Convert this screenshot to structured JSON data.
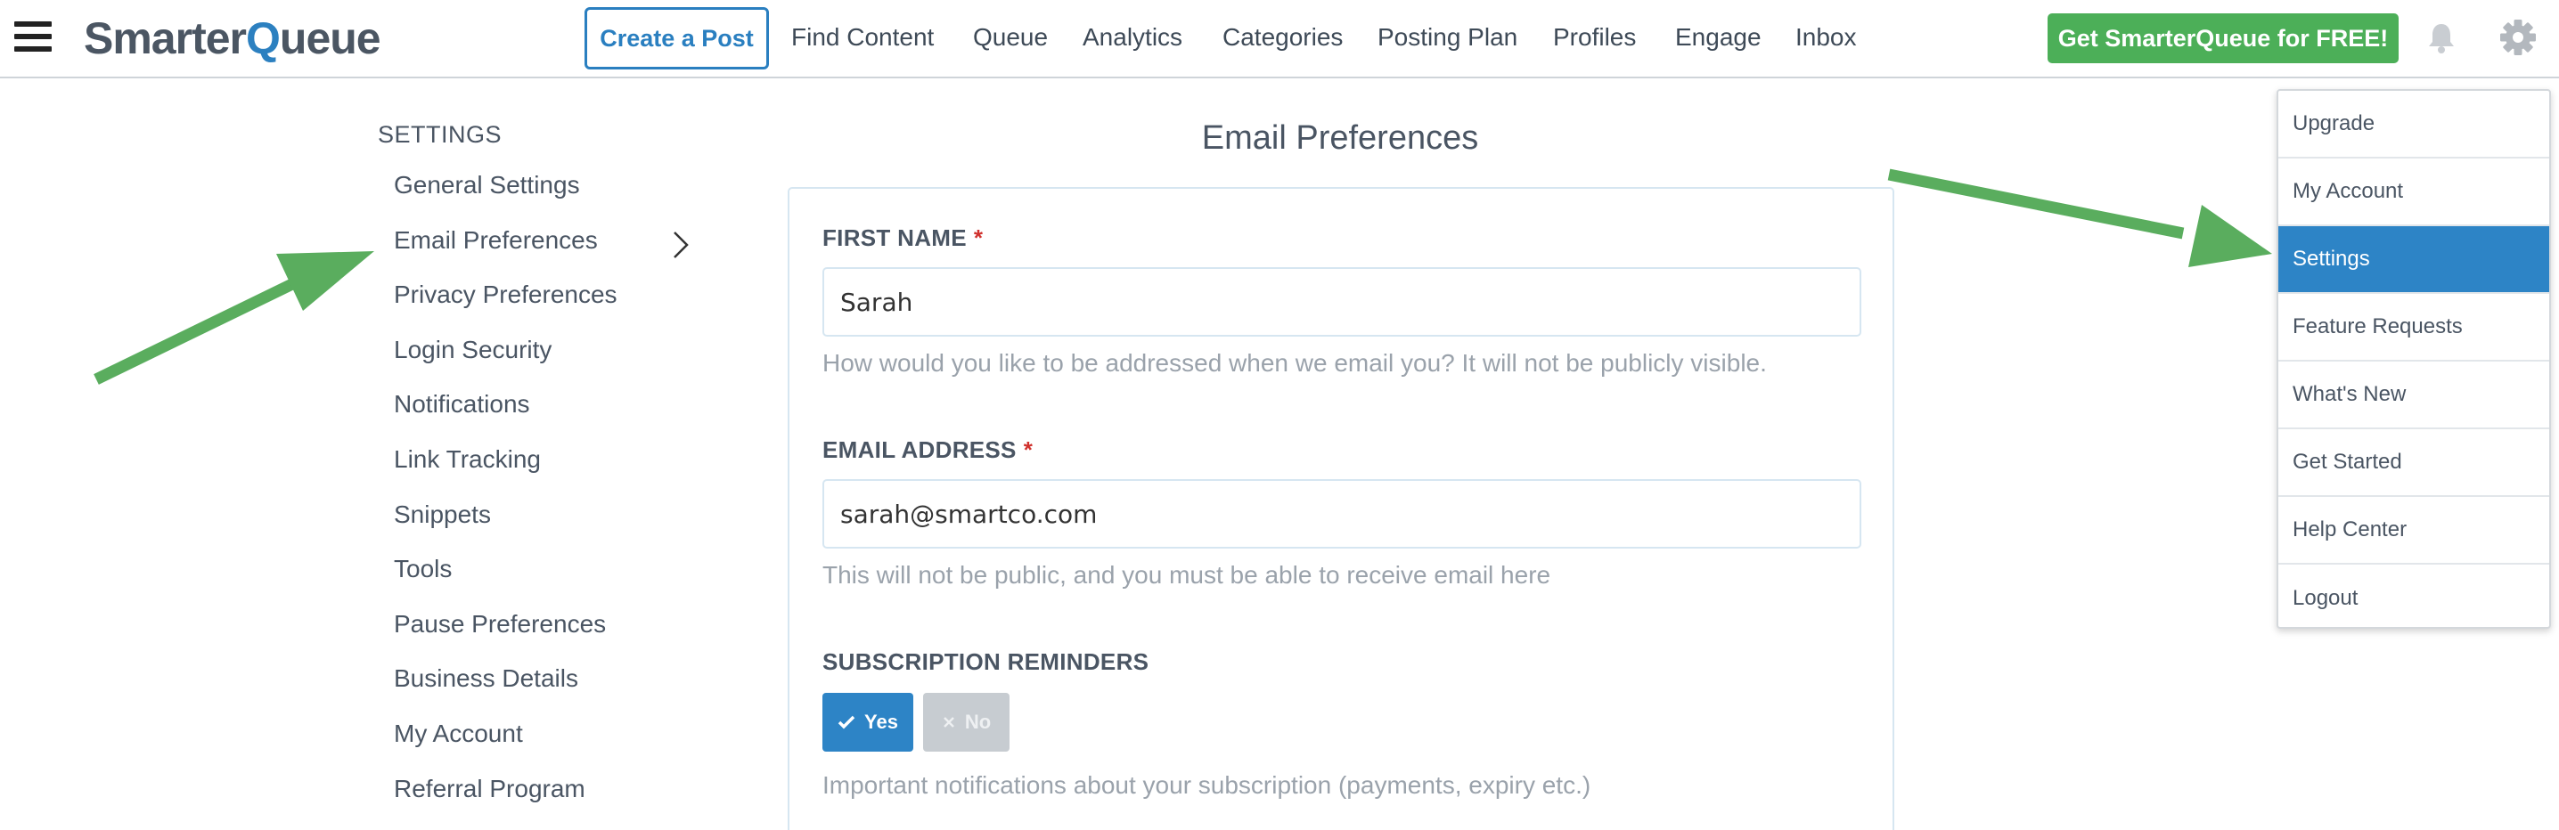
{
  "header": {
    "logo": {
      "part1": "Smarter",
      "part2": "Q",
      "part3": "ueue"
    },
    "create_post": "Create a Post",
    "nav": [
      "Find Content",
      "Queue",
      "Analytics",
      "Categories",
      "Posting Plan",
      "Profiles",
      "Engage",
      "Inbox"
    ],
    "cta": "Get SmarterQueue for FREE!",
    "icons": {
      "menu": "hamburger-menu-icon",
      "notifications": "bell-icon",
      "settings": "gear-icon"
    }
  },
  "sidebar": {
    "heading": "SETTINGS",
    "items": [
      "General Settings",
      "Email Preferences",
      "Privacy Preferences",
      "Login Security",
      "Notifications",
      "Link Tracking",
      "Snippets",
      "Tools",
      "Pause Preferences",
      "Business Details",
      "My Account",
      "Referral Program"
    ],
    "active": "Email Preferences"
  },
  "main": {
    "title": "Email Preferences",
    "first_name": {
      "label": "FIRST NAME",
      "required": "*",
      "value": "Sarah",
      "help": "How would you like to be addressed when we email you? It will not be publicly visible."
    },
    "email": {
      "label": "EMAIL ADDRESS",
      "required": "*",
      "value": "sarah@smartco.com",
      "help": "This will not be public, and you must be able to receive email here"
    },
    "subscription": {
      "label": "SUBSCRIPTION REMINDERS",
      "yes": "Yes",
      "no": "No",
      "selected": "Yes",
      "help": "Important notifications about your subscription (payments, expiry etc.)"
    }
  },
  "dropdown": {
    "items": [
      "Upgrade",
      "My Account",
      "Settings",
      "Feature Requests",
      "What's New",
      "Get Started",
      "Help Center",
      "Logout"
    ],
    "active": "Settings"
  },
  "colors": {
    "brand_blue": "#2d84c6",
    "cta_green": "#4caf58",
    "annotation_arrow": "#5aad5e",
    "required": "#d0312d"
  }
}
